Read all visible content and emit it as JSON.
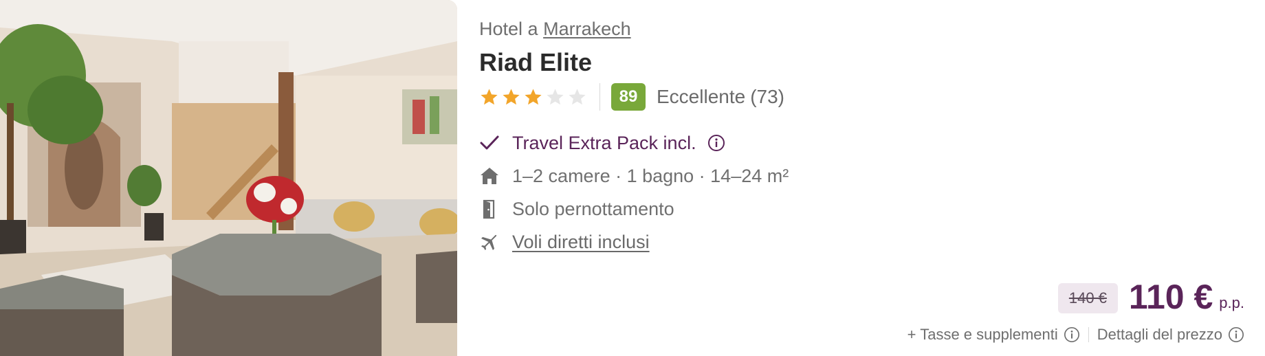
{
  "listing": {
    "location_prefix": "Hotel a",
    "location_link": "Marrakech",
    "name": "Riad Elite",
    "stars": 3,
    "max_stars": 5,
    "score": "89",
    "score_label": "Eccellente",
    "review_count": "(73)"
  },
  "features": {
    "pack_label": "Travel Extra Pack incl.",
    "rooms_label": "1–2 camere · 1 bagno · 14–24 m²",
    "board_label": "Solo pernottamento",
    "flights_label": "Voli diretti inclusi"
  },
  "pricing": {
    "old_price": "140 €",
    "price": "110 €",
    "per_person": "p.p."
  },
  "footer": {
    "taxes_link": "+ Tasse e supplementi",
    "price_details_link": "Dettagli del prezzo"
  },
  "colors": {
    "accent_purple": "#5a2459",
    "score_green": "#79a83a",
    "star_gold": "#f2a52a",
    "star_empty": "#e6e6e6"
  },
  "icons": {
    "check": "check-icon",
    "info": "info-icon",
    "home": "home-icon",
    "door": "door-icon",
    "plane": "plane-icon"
  }
}
